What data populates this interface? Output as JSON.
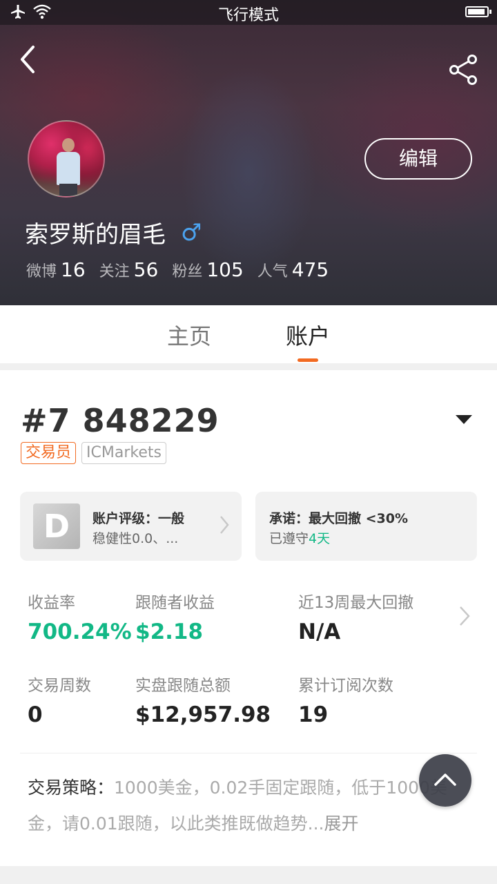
{
  "statusbar": {
    "title": "飞行模式",
    "icons": [
      "airplane-icon",
      "wifi-icon",
      "battery-icon"
    ]
  },
  "header": {
    "back_icon": "chevron-left-icon",
    "share_icon": "share-icon"
  },
  "profile": {
    "name": "索罗斯的眉毛",
    "gender_symbol": "♂",
    "edit_label": "编辑",
    "stats": [
      {
        "label": "微博",
        "value": "16"
      },
      {
        "label": "关注",
        "value": "56"
      },
      {
        "label": "粉丝",
        "value": "105"
      },
      {
        "label": "人气",
        "value": "475"
      }
    ]
  },
  "tabs": [
    {
      "label": "主页",
      "active": false
    },
    {
      "label": "账户",
      "active": true
    }
  ],
  "account": {
    "id": "#7 848229",
    "tags": [
      "交易员",
      "ICMarkets"
    ],
    "rating_card": {
      "grade": "D",
      "title": "账户评级：一般",
      "subtitle": "稳健性0.0、..."
    },
    "promise_card": {
      "title": "承诺：最大回撤 <30%",
      "kept_prefix": "已遵守",
      "kept_days": "4天"
    },
    "metrics": [
      {
        "label": "收益率",
        "value": "700.24%",
        "green": true
      },
      {
        "label": "跟随者收益",
        "value": "$2.18",
        "green": true
      },
      {
        "label": "近13周最大回撤",
        "value": "N/A",
        "green": false
      },
      {
        "label": "交易周数",
        "value": "0",
        "green": false
      },
      {
        "label": "实盘跟随总额",
        "value": "$12,957.98",
        "green": false
      },
      {
        "label": "累计订阅次数",
        "value": "19",
        "green": false
      }
    ],
    "strategy": {
      "label": "交易策略：",
      "text": "1000美金，0.02手固定跟随，低于1000美金，请0.01跟随，以此类推既做趋势...",
      "more": "展开"
    }
  },
  "colors": {
    "accent": "#f26a21",
    "green": "#12b886",
    "gender": "#4ba3f0"
  }
}
